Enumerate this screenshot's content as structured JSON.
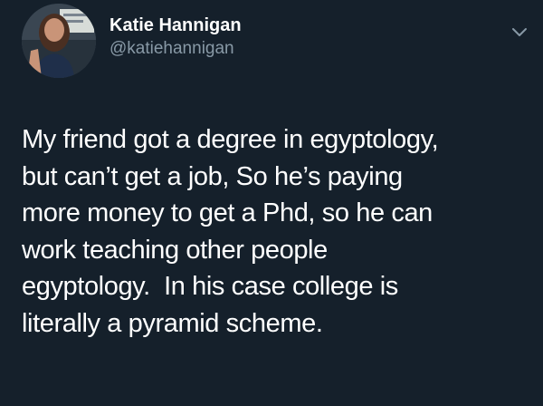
{
  "tweet": {
    "author": {
      "display_name": "Katie Hannigan",
      "handle": "@katiehannigan",
      "avatar_icon": "profile-photo"
    },
    "menu_icon": "chevron-down-icon",
    "text_lines": [
      "My friend got a degree in egyptology,",
      "but can’t get a job, So he’s paying",
      "more money to get a Phd, so he can",
      "work teaching other people",
      "egyptology.  In his case college is",
      "literally a pyramid scheme."
    ]
  },
  "colors": {
    "background": "#15202b",
    "primary_text": "#ffffff",
    "secondary_text": "#8899a6",
    "icon": "#8899a6"
  }
}
